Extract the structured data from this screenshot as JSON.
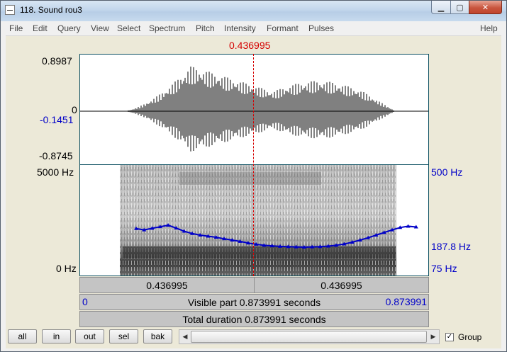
{
  "window": {
    "title": "118. Sound rou3",
    "minimize_glyph": "▁",
    "maximize_glyph": "▢",
    "close_glyph": "✕",
    "icon": "praat-app-icon"
  },
  "menu": {
    "items": [
      "File",
      "Edit",
      "Query",
      "View",
      "Select",
      "Spectrum",
      "Pitch",
      "Intensity",
      "Formant",
      "Pulses"
    ],
    "help": "Help"
  },
  "cursor": {
    "time_label": "0.436995",
    "time": 0.436995
  },
  "waveform": {
    "max_label": "0.8987",
    "zero_label": "0",
    "cursor_value_label": "-0.1451",
    "min_label": "-0.8745"
  },
  "spectrogram": {
    "freq_top_label": "5000 Hz",
    "freq_bottom_label": "0 Hz",
    "pitch_top_label": "500 Hz",
    "pitch_cursor_label": "187.8 Hz",
    "pitch_bottom_label": "75 Hz"
  },
  "bars": {
    "left_selection": "0.436995",
    "right_selection": "0.436995",
    "visible_start": "0",
    "visible_part": "Visible part 0.873991 seconds",
    "visible_end": "0.873991",
    "total_duration": "Total duration 0.873991 seconds"
  },
  "bottom": {
    "buttons": [
      "all",
      "in",
      "out",
      "sel",
      "bak"
    ],
    "group_label": "Group",
    "group_checked": true,
    "scroll_left_glyph": "◀",
    "scroll_right_glyph": "▶"
  },
  "colors": {
    "cursor": "#d40000",
    "pitch": "#0000c8",
    "frame": "#0b4f60"
  },
  "chart_data": {
    "type": "line",
    "duration_s": 0.873991,
    "pitch_range_hz": [
      75,
      500
    ],
    "pitch_track": {
      "x": [
        0.14,
        0.16,
        0.18,
        0.2,
        0.22,
        0.24,
        0.26,
        0.28,
        0.3,
        0.32,
        0.34,
        0.36,
        0.38,
        0.4,
        0.42,
        0.44,
        0.46,
        0.48,
        0.5,
        0.52,
        0.54,
        0.56,
        0.58,
        0.6,
        0.62,
        0.64,
        0.66,
        0.68,
        0.7,
        0.72,
        0.74,
        0.76,
        0.78,
        0.8,
        0.82,
        0.84
      ],
      "y": [
        257,
        252,
        258,
        264,
        270,
        259,
        247,
        238,
        232,
        228,
        224,
        218,
        213,
        208,
        202,
        197,
        193,
        191,
        189,
        188,
        187,
        186,
        187,
        188,
        190,
        193,
        198,
        205,
        213,
        222,
        232,
        242,
        252,
        261,
        266,
        263
      ]
    },
    "waveform_range": [
      -0.8745,
      0.8987
    ]
  }
}
